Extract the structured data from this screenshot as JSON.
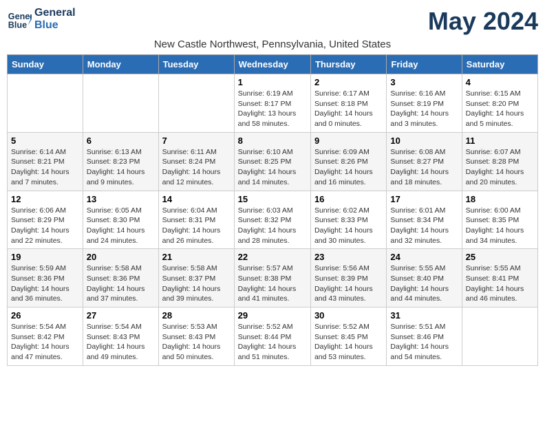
{
  "header": {
    "logo_line1": "General",
    "logo_line2": "Blue",
    "month_title": "May 2024",
    "location": "New Castle Northwest, Pennsylvania, United States"
  },
  "weekdays": [
    "Sunday",
    "Monday",
    "Tuesday",
    "Wednesday",
    "Thursday",
    "Friday",
    "Saturday"
  ],
  "weeks": [
    [
      {
        "day": "",
        "info": ""
      },
      {
        "day": "",
        "info": ""
      },
      {
        "day": "",
        "info": ""
      },
      {
        "day": "1",
        "sunrise": "6:19 AM",
        "sunset": "8:17 PM",
        "daylight": "13 hours and 58 minutes."
      },
      {
        "day": "2",
        "sunrise": "6:17 AM",
        "sunset": "8:18 PM",
        "daylight": "14 hours and 0 minutes."
      },
      {
        "day": "3",
        "sunrise": "6:16 AM",
        "sunset": "8:19 PM",
        "daylight": "14 hours and 3 minutes."
      },
      {
        "day": "4",
        "sunrise": "6:15 AM",
        "sunset": "8:20 PM",
        "daylight": "14 hours and 5 minutes."
      }
    ],
    [
      {
        "day": "5",
        "sunrise": "6:14 AM",
        "sunset": "8:21 PM",
        "daylight": "14 hours and 7 minutes."
      },
      {
        "day": "6",
        "sunrise": "6:13 AM",
        "sunset": "8:23 PM",
        "daylight": "14 hours and 9 minutes."
      },
      {
        "day": "7",
        "sunrise": "6:11 AM",
        "sunset": "8:24 PM",
        "daylight": "14 hours and 12 minutes."
      },
      {
        "day": "8",
        "sunrise": "6:10 AM",
        "sunset": "8:25 PM",
        "daylight": "14 hours and 14 minutes."
      },
      {
        "day": "9",
        "sunrise": "6:09 AM",
        "sunset": "8:26 PM",
        "daylight": "14 hours and 16 minutes."
      },
      {
        "day": "10",
        "sunrise": "6:08 AM",
        "sunset": "8:27 PM",
        "daylight": "14 hours and 18 minutes."
      },
      {
        "day": "11",
        "sunrise": "6:07 AM",
        "sunset": "8:28 PM",
        "daylight": "14 hours and 20 minutes."
      }
    ],
    [
      {
        "day": "12",
        "sunrise": "6:06 AM",
        "sunset": "8:29 PM",
        "daylight": "14 hours and 22 minutes."
      },
      {
        "day": "13",
        "sunrise": "6:05 AM",
        "sunset": "8:30 PM",
        "daylight": "14 hours and 24 minutes."
      },
      {
        "day": "14",
        "sunrise": "6:04 AM",
        "sunset": "8:31 PM",
        "daylight": "14 hours and 26 minutes."
      },
      {
        "day": "15",
        "sunrise": "6:03 AM",
        "sunset": "8:32 PM",
        "daylight": "14 hours and 28 minutes."
      },
      {
        "day": "16",
        "sunrise": "6:02 AM",
        "sunset": "8:33 PM",
        "daylight": "14 hours and 30 minutes."
      },
      {
        "day": "17",
        "sunrise": "6:01 AM",
        "sunset": "8:34 PM",
        "daylight": "14 hours and 32 minutes."
      },
      {
        "day": "18",
        "sunrise": "6:00 AM",
        "sunset": "8:35 PM",
        "daylight": "14 hours and 34 minutes."
      }
    ],
    [
      {
        "day": "19",
        "sunrise": "5:59 AM",
        "sunset": "8:36 PM",
        "daylight": "14 hours and 36 minutes."
      },
      {
        "day": "20",
        "sunrise": "5:58 AM",
        "sunset": "8:36 PM",
        "daylight": "14 hours and 37 minutes."
      },
      {
        "day": "21",
        "sunrise": "5:58 AM",
        "sunset": "8:37 PM",
        "daylight": "14 hours and 39 minutes."
      },
      {
        "day": "22",
        "sunrise": "5:57 AM",
        "sunset": "8:38 PM",
        "daylight": "14 hours and 41 minutes."
      },
      {
        "day": "23",
        "sunrise": "5:56 AM",
        "sunset": "8:39 PM",
        "daylight": "14 hours and 43 minutes."
      },
      {
        "day": "24",
        "sunrise": "5:55 AM",
        "sunset": "8:40 PM",
        "daylight": "14 hours and 44 minutes."
      },
      {
        "day": "25",
        "sunrise": "5:55 AM",
        "sunset": "8:41 PM",
        "daylight": "14 hours and 46 minutes."
      }
    ],
    [
      {
        "day": "26",
        "sunrise": "5:54 AM",
        "sunset": "8:42 PM",
        "daylight": "14 hours and 47 minutes."
      },
      {
        "day": "27",
        "sunrise": "5:54 AM",
        "sunset": "8:43 PM",
        "daylight": "14 hours and 49 minutes."
      },
      {
        "day": "28",
        "sunrise": "5:53 AM",
        "sunset": "8:43 PM",
        "daylight": "14 hours and 50 minutes."
      },
      {
        "day": "29",
        "sunrise": "5:52 AM",
        "sunset": "8:44 PM",
        "daylight": "14 hours and 51 minutes."
      },
      {
        "day": "30",
        "sunrise": "5:52 AM",
        "sunset": "8:45 PM",
        "daylight": "14 hours and 53 minutes."
      },
      {
        "day": "31",
        "sunrise": "5:51 AM",
        "sunset": "8:46 PM",
        "daylight": "14 hours and 54 minutes."
      },
      {
        "day": "",
        "info": ""
      }
    ]
  ],
  "labels": {
    "sunrise_label": "Sunrise:",
    "sunset_label": "Sunset:",
    "daylight_label": "Daylight:"
  }
}
